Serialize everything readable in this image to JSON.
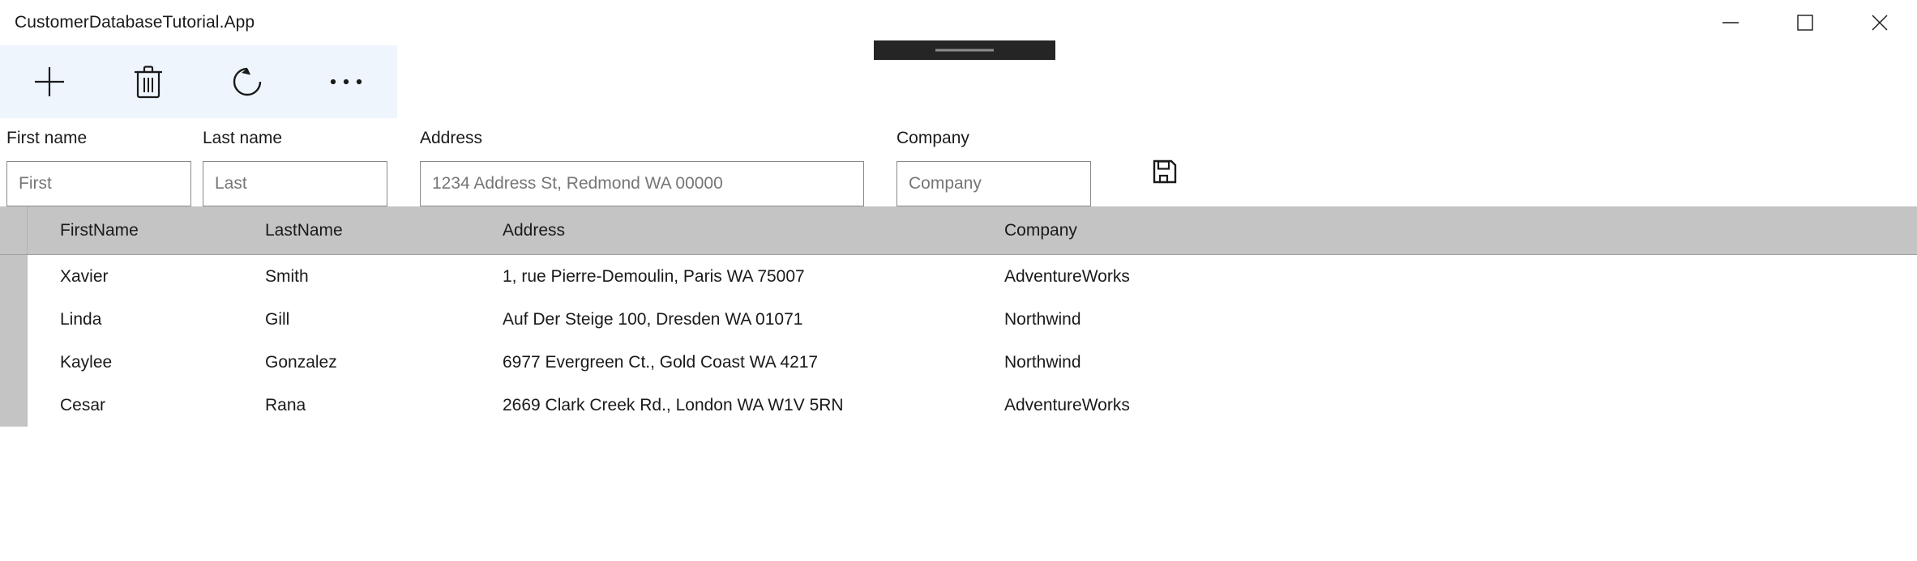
{
  "window": {
    "title": "CustomerDatabaseTutorial.App",
    "controls": [
      {
        "name": "minimize",
        "label": "Minimize"
      },
      {
        "name": "maximize",
        "label": "Maximize"
      },
      {
        "name": "close",
        "label": "Close"
      }
    ],
    "accent_toolbar_color": "#eef5fc",
    "header_row_color": "#c4c4c4"
  },
  "toolbar": {
    "buttons": [
      {
        "icon": "plus-icon",
        "label": "Add"
      },
      {
        "icon": "trash-icon",
        "label": "Delete"
      },
      {
        "icon": "refresh-icon",
        "label": "Refresh"
      },
      {
        "icon": "ellipsis-icon",
        "label": "More"
      }
    ]
  },
  "form": {
    "first_name": {
      "label": "First name",
      "value": "",
      "placeholder": "First"
    },
    "last_name": {
      "label": "Last name",
      "value": "",
      "placeholder": "Last"
    },
    "address": {
      "label": "Address",
      "value": "",
      "placeholder": "1234 Address St, Redmond WA 00000"
    },
    "company": {
      "label": "Company",
      "value": "",
      "placeholder": "Company"
    },
    "save": {
      "icon": "save-floppy-icon",
      "label": "Save"
    }
  },
  "grid": {
    "columns": [
      {
        "key": "first_name",
        "header": "FirstName"
      },
      {
        "key": "last_name",
        "header": "LastName"
      },
      {
        "key": "address",
        "header": "Address"
      },
      {
        "key": "company",
        "header": "Company"
      }
    ],
    "rows": [
      {
        "first_name": "Xavier",
        "last_name": "Smith",
        "address": "1, rue Pierre-Demoulin, Paris WA 75007",
        "company": "AdventureWorks"
      },
      {
        "first_name": "Linda",
        "last_name": "Gill",
        "address": "Auf Der Steige 100, Dresden WA 01071",
        "company": "Northwind"
      },
      {
        "first_name": "Kaylee",
        "last_name": "Gonzalez",
        "address": "6977 Evergreen Ct., Gold Coast WA 4217",
        "company": "Northwind"
      },
      {
        "first_name": "Cesar",
        "last_name": "Rana",
        "address": "2669 Clark Creek Rd., London WA W1V 5RN",
        "company": "AdventureWorks"
      }
    ]
  }
}
